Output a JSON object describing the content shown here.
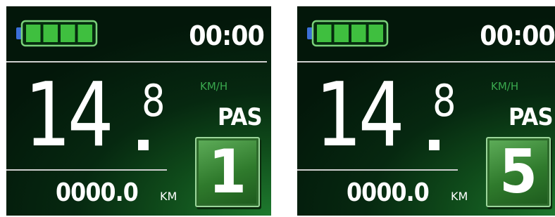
{
  "colors": {
    "background": "#ffffff",
    "screen_bg": "#03170a",
    "screen_glow": "#1e7a2e",
    "battery_frame": "#7ad27a",
    "battery_cell": "#3fbf3f",
    "battery_terminal": "#3b6fd8",
    "unit_text": "#3aa84e",
    "primary_text": "#ffffff",
    "pas_box": "#2f7a2c"
  },
  "icons": {
    "battery": "battery-icon"
  },
  "screens": [
    {
      "battery": {
        "level": 1.0,
        "cells": 4,
        "filled": 4
      },
      "time": "00:00",
      "speed": {
        "integer": "14",
        "decimal": "8",
        "unit": "KM/H"
      },
      "pas": {
        "label": "PAS",
        "level": "1"
      },
      "odometer": {
        "value": "0000.0",
        "unit": "KM"
      }
    },
    {
      "battery": {
        "level": 1.0,
        "cells": 4,
        "filled": 4
      },
      "time": "00:00",
      "speed": {
        "integer": "14",
        "decimal": "8",
        "unit": "KM/H"
      },
      "pas": {
        "label": "PAS",
        "level": "5"
      },
      "odometer": {
        "value": "0000.0",
        "unit": "KM"
      }
    }
  ]
}
